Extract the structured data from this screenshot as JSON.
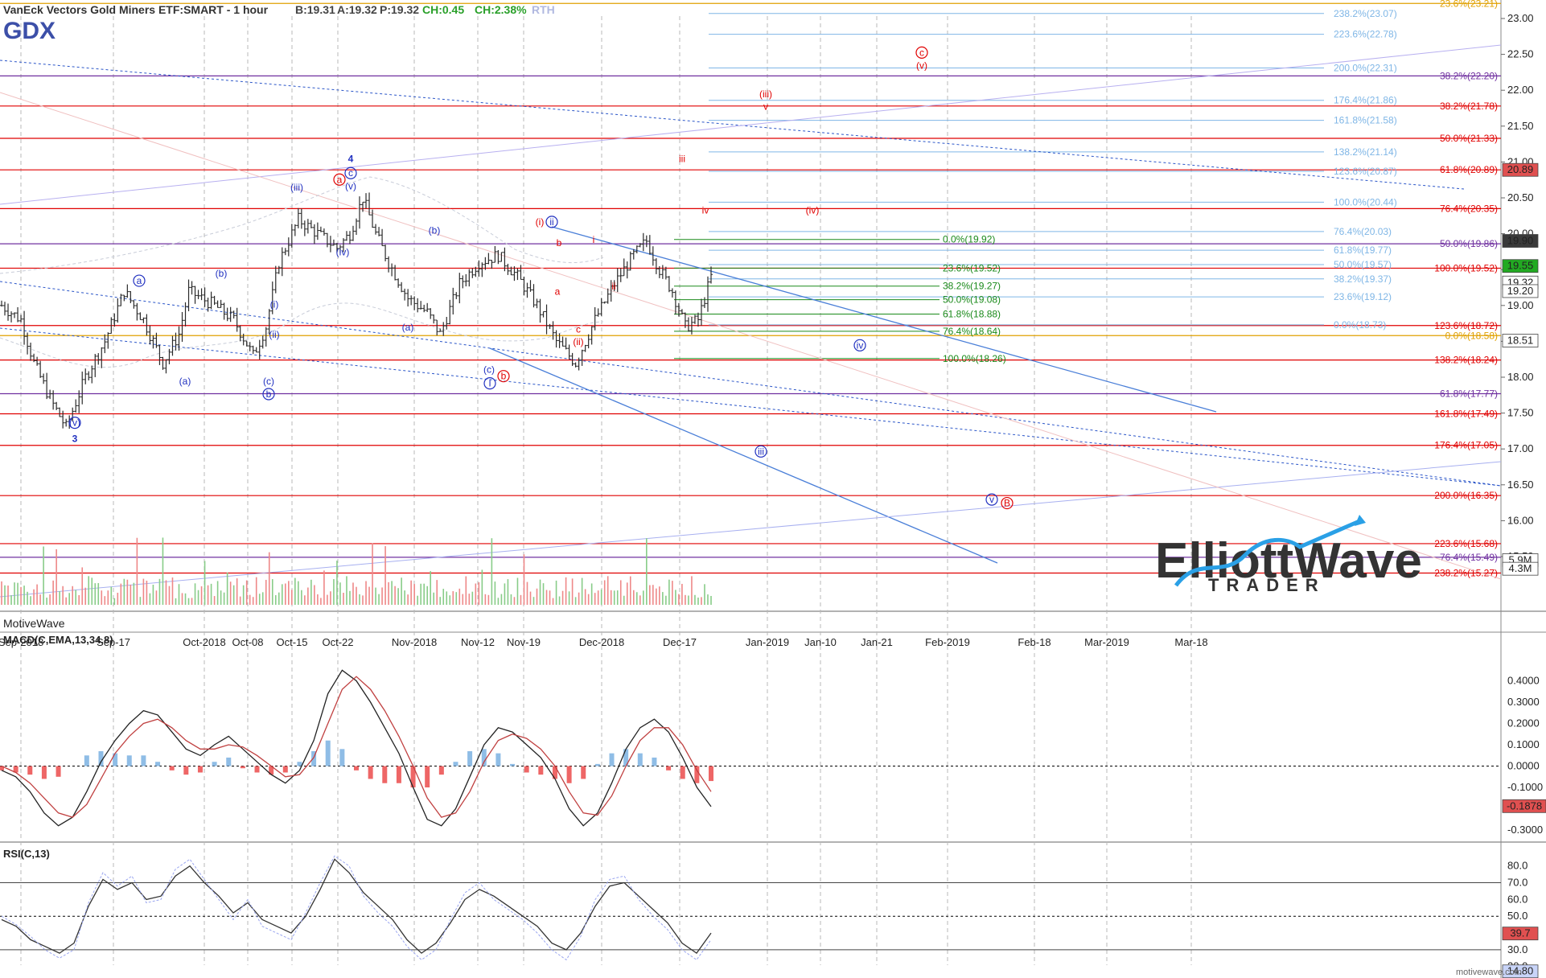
{
  "header": {
    "title": "VanEck Vectors Gold Miners ETF:SMART - 1 hour",
    "symbol": "GDX",
    "bid": "B:19.31",
    "ask": "A:19.32",
    "price": "P:19.32",
    "change": "CH:0.45",
    "change_pct": "CH:2.38%",
    "session": "RTH"
  },
  "watermark": "MotiveWave",
  "footer_brand": "motivewave.com",
  "logo": {
    "line1": "ElliottWave",
    "line2": "TRADER"
  },
  "colors": {
    "price_up": "#2a2a2a",
    "fib_red": "#e00000",
    "fib_purple": "#7030a0",
    "fib_lightblue": "#7fb6e6",
    "fib_green": "#1a8a1a",
    "wave_blue": "#2030c0",
    "wave_red": "#e00000",
    "trend_blue": "#4a7fd8",
    "logo_dark": "#333333",
    "logo_blue": "#2aa0e6",
    "volume_green": "#88cc88",
    "volume_red": "#ee8888",
    "macd_hist_pos": "#8fbde6",
    "macd_hist_neg": "#ee6666"
  },
  "chart_data": [
    {
      "type": "candlestick",
      "title": "VanEck Vectors Gold Miners ETF:SMART - 1 hour",
      "ylim": [
        15.1,
        23.3
      ],
      "x_tick_labels": [
        "Sep-2018",
        "Sep-17",
        "Oct-2018",
        "Oct-08",
        "Oct-15",
        "Oct-22",
        "Nov-2018",
        "Nov-12",
        "Nov-19",
        "Dec-2018",
        "Dec-17",
        "Jan-2019",
        "Jan-10",
        "Jan-21",
        "Feb-2019",
        "Feb-18",
        "Mar-2019",
        "Mar-18"
      ],
      "y_tick_labels": [
        "23.00",
        "22.50",
        "22.00",
        "21.50",
        "21.00",
        "20.50",
        "20.00",
        "19.50",
        "19.00",
        "18.50",
        "18.00",
        "17.50",
        "17.00",
        "16.50",
        "16.00",
        "15.50"
      ],
      "price_path": [
        [
          0,
          19.0
        ],
        [
          6,
          18.8
        ],
        [
          10,
          18.2
        ],
        [
          15,
          17.7
        ],
        [
          20,
          17.3
        ],
        [
          26,
          18.0
        ],
        [
          32,
          18.5
        ],
        [
          38,
          19.2
        ],
        [
          44,
          18.8
        ],
        [
          50,
          18.2
        ],
        [
          55,
          18.6
        ],
        [
          58,
          19.2
        ],
        [
          66,
          19.0
        ],
        [
          72,
          18.8
        ],
        [
          78,
          18.3
        ],
        [
          82,
          18.7
        ],
        [
          86,
          19.6
        ],
        [
          92,
          20.2
        ],
        [
          98,
          20.0
        ],
        [
          104,
          19.8
        ],
        [
          108,
          20.0
        ],
        [
          112,
          20.5
        ],
        [
          116,
          20.0
        ],
        [
          120,
          19.6
        ],
        [
          126,
          19.1
        ],
        [
          132,
          18.9
        ],
        [
          136,
          18.6
        ],
        [
          142,
          19.3
        ],
        [
          148,
          19.6
        ],
        [
          154,
          19.7
        ],
        [
          160,
          19.4
        ],
        [
          166,
          19.0
        ],
        [
          172,
          18.5
        ],
        [
          178,
          18.2
        ],
        [
          184,
          18.8
        ],
        [
          190,
          19.3
        ],
        [
          196,
          19.7
        ],
        [
          200,
          19.9
        ],
        [
          204,
          19.5
        ],
        [
          208,
          19.2
        ],
        [
          212,
          18.7
        ],
        [
          216,
          18.8
        ],
        [
          220,
          19.4
        ]
      ],
      "fib_levels_right": [
        {
          "label": "23.6%(23.21)",
          "value": 23.21,
          "color": "#e0a000"
        },
        {
          "label": "38.2%(22.20)",
          "value": 22.2,
          "color": "#7030a0"
        },
        {
          "label": "38.2%(21.78)",
          "value": 21.78,
          "color": "#e00000"
        },
        {
          "label": "50.0%(21.33)",
          "value": 21.33,
          "color": "#e00000"
        },
        {
          "label": "61.8%(20.89)",
          "value": 20.89,
          "color": "#e00000"
        },
        {
          "label": "76.4%(20.35)",
          "value": 20.35,
          "color": "#e00000"
        },
        {
          "label": "50.0%(19.86)",
          "value": 19.86,
          "color": "#7030a0"
        },
        {
          "label": "100.0%(19.52)",
          "value": 19.52,
          "color": "#e00000"
        },
        {
          "label": "123.6%(18.72)",
          "value": 18.72,
          "color": "#e00000"
        },
        {
          "label": "0.0%(18.58)",
          "value": 18.58,
          "color": "#e0a000"
        },
        {
          "label": "138.2%(18.24)",
          "value": 18.24,
          "color": "#e00000"
        },
        {
          "label": "61.8%(17.77)",
          "value": 17.77,
          "color": "#7030a0"
        },
        {
          "label": "161.8%(17.49)",
          "value": 17.49,
          "color": "#e00000"
        },
        {
          "label": "176.4%(17.05)",
          "value": 17.05,
          "color": "#e00000"
        },
        {
          "label": "200.0%(16.35)",
          "value": 16.35,
          "color": "#e00000"
        },
        {
          "label": "223.6%(15.68)",
          "value": 15.68,
          "color": "#e00000"
        },
        {
          "label": "76.4%(15.49)",
          "value": 15.49,
          "color": "#7030a0"
        },
        {
          "label": "238.2%(15.27)",
          "value": 15.27,
          "color": "#e00000"
        }
      ],
      "fib_levels_mid": [
        {
          "label": "238.2%(23.07)",
          "value": 23.07
        },
        {
          "label": "223.6%(22.78)",
          "value": 22.78
        },
        {
          "label": "200.0%(22.31)",
          "value": 22.31
        },
        {
          "label": "176.4%(21.86)",
          "value": 21.86
        },
        {
          "label": "161.8%(21.58)",
          "value": 21.58
        },
        {
          "label": "138.2%(21.14)",
          "value": 21.14
        },
        {
          "label": "123.6%(20.87)",
          "value": 20.87
        },
        {
          "label": "100.0%(20.44)",
          "value": 20.44
        },
        {
          "label": "76.4%(20.03)",
          "value": 20.03
        },
        {
          "label": "61.8%(19.77)",
          "value": 19.77
        },
        {
          "label": "50.0%(19.57)",
          "value": 19.57
        },
        {
          "label": "38.2%(19.37)",
          "value": 19.37
        },
        {
          "label": "23.6%(19.12)",
          "value": 19.12
        },
        {
          "label": "0.0%(18.73)",
          "value": 18.73
        }
      ],
      "fib_levels_green": [
        {
          "label": "0.0%(19.92)",
          "value": 19.92
        },
        {
          "label": "23.6%(19.52)",
          "value": 19.52
        },
        {
          "label": "38.2%(19.27)",
          "value": 19.27
        },
        {
          "label": "50.0%(19.08)",
          "value": 19.08
        },
        {
          "label": "61.8%(18.88)",
          "value": 18.88
        },
        {
          "label": "76.4%(18.64)",
          "value": 18.64
        },
        {
          "label": "100.0%(18.26)",
          "value": 18.26
        }
      ],
      "price_badges": [
        {
          "label": "20.89",
          "value": 20.89,
          "bg": "#e05050",
          "fg": "#000"
        },
        {
          "label": "19.90",
          "value": 19.9,
          "bg": "#3a3a3a",
          "fg": "#fff"
        },
        {
          "label": "19.55",
          "value": 19.55,
          "bg": "#22aa22",
          "fg": "#fff"
        },
        {
          "label": "19.32",
          "value": 19.32,
          "bg": "#ffffff",
          "fg": "#000"
        },
        {
          "label": "19.20",
          "value": 19.2,
          "bg": "#ffffff",
          "fg": "#000"
        },
        {
          "label": "18.51",
          "value": 18.51,
          "bg": "#ffffff",
          "fg": "#000"
        },
        {
          "label": "5.9M",
          "value": 15.45,
          "bg": "#ffffff",
          "fg": "#000"
        },
        {
          "label": "4.3M",
          "value": 15.33,
          "bg": "#ffffff",
          "fg": "#000"
        }
      ],
      "wave_labels": [
        {
          "t": "(v)",
          "x": 93,
          "v": 17.32,
          "c": "#2030c0",
          "circ": true
        },
        {
          "t": "3",
          "x": 93,
          "v": 17.1,
          "c": "#2030c0",
          "circ": false
        },
        {
          "t": "a",
          "x": 173,
          "v": 19.3,
          "c": "#2030c0",
          "circ": true
        },
        {
          "t": "(a)",
          "x": 230,
          "v": 17.9,
          "c": "#2030c0",
          "circ": false
        },
        {
          "t": "(b)",
          "x": 275,
          "v": 19.4,
          "c": "#2030c0",
          "circ": false
        },
        {
          "t": "(i)",
          "x": 341,
          "v": 18.97,
          "c": "#2030c0",
          "circ": false
        },
        {
          "t": "(ii)",
          "x": 341,
          "v": 18.55,
          "c": "#2030c0",
          "circ": false
        },
        {
          "t": "(c)",
          "x": 334,
          "v": 17.9,
          "c": "#2030c0",
          "circ": false
        },
        {
          "t": "b",
          "x": 334,
          "v": 17.72,
          "c": "#2030c0",
          "circ": true
        },
        {
          "t": "(iii)",
          "x": 369,
          "v": 20.6,
          "c": "#2030c0",
          "circ": false
        },
        {
          "t": "(iv)",
          "x": 426,
          "v": 19.7,
          "c": "#2030c0",
          "circ": false
        },
        {
          "t": "4",
          "x": 436,
          "v": 21.0,
          "c": "#2030c0",
          "circ": false
        },
        {
          "t": "c",
          "x": 436,
          "v": 20.8,
          "c": "#2030c0",
          "circ": true
        },
        {
          "t": "(v)",
          "x": 436,
          "v": 20.62,
          "c": "#2030c0",
          "circ": false
        },
        {
          "t": "a",
          "x": 422,
          "v": 20.71,
          "c": "#e00000",
          "circ": true
        },
        {
          "t": "(b)",
          "x": 540,
          "v": 20.0,
          "c": "#2030c0",
          "circ": false
        },
        {
          "t": "(a)",
          "x": 507,
          "v": 18.65,
          "c": "#2030c0",
          "circ": false
        },
        {
          "t": "(c)",
          "x": 608,
          "v": 18.06,
          "c": "#2030c0",
          "circ": false
        },
        {
          "t": "I",
          "x": 609,
          "v": 17.87,
          "c": "#2030c0",
          "circ": true
        },
        {
          "t": "b",
          "x": 626,
          "v": 17.97,
          "c": "#e00000",
          "circ": true
        },
        {
          "t": "(i)",
          "x": 671,
          "v": 20.12,
          "c": "#e00000",
          "circ": false
        },
        {
          "t": "ii",
          "x": 686,
          "v": 20.12,
          "c": "#2030c0",
          "circ": true
        },
        {
          "t": "b",
          "x": 695,
          "v": 19.83,
          "c": "#e00000",
          "circ": false
        },
        {
          "t": "a",
          "x": 693,
          "v": 19.15,
          "c": "#e00000",
          "circ": false
        },
        {
          "t": "c",
          "x": 719,
          "v": 18.62,
          "c": "#e00000",
          "circ": false
        },
        {
          "t": "(ii)",
          "x": 719,
          "v": 18.45,
          "c": "#e00000",
          "circ": false
        },
        {
          "t": "i",
          "x": 738,
          "v": 19.87,
          "c": "#e00000",
          "circ": false
        },
        {
          "t": "ii",
          "x": 763,
          "v": 19.22,
          "c": "#e00000",
          "circ": false
        },
        {
          "t": "iii",
          "x": 848,
          "v": 21.0,
          "c": "#e00000",
          "circ": false
        },
        {
          "t": "iv",
          "x": 877,
          "v": 20.28,
          "c": "#e00000",
          "circ": false
        },
        {
          "t": "(iii)",
          "x": 952,
          "v": 21.9,
          "c": "#e00000",
          "circ": false
        },
        {
          "t": "v",
          "x": 952,
          "v": 21.73,
          "c": "#e00000",
          "circ": false
        },
        {
          "t": "(iv)",
          "x": 1010,
          "v": 20.28,
          "c": "#e00000",
          "circ": false
        },
        {
          "t": "c",
          "x": 1146,
          "v": 22.48,
          "c": "#e00000",
          "circ": true
        },
        {
          "t": "(v)",
          "x": 1146,
          "v": 22.3,
          "c": "#e00000",
          "circ": false
        },
        {
          "t": "iv",
          "x": 1069,
          "v": 18.4,
          "c": "#2030c0",
          "circ": true
        },
        {
          "t": "iii",
          "x": 946,
          "v": 16.92,
          "c": "#2030c0",
          "circ": true
        },
        {
          "t": "v",
          "x": 1233,
          "v": 16.25,
          "c": "#2030c0",
          "circ": true
        },
        {
          "t": "B",
          "x": 1252,
          "v": 16.2,
          "c": "#e00000",
          "circ": true
        }
      ]
    },
    {
      "type": "line",
      "title": "MACD(C,EMA,13,34,8)",
      "ylim": [
        -0.33,
        0.5
      ],
      "y_tick_labels": [
        "0.4000",
        "0.3000",
        "0.2000",
        "0.1000",
        "0.0000",
        "-0.1000",
        "-0.2000",
        "-0.3000"
      ],
      "current_value": "-0.1878",
      "series": [
        {
          "values": [
            -0.02,
            -0.05,
            -0.12,
            -0.22,
            -0.28,
            -0.24,
            -0.12,
            0.02,
            0.12,
            0.2,
            0.26,
            0.24,
            0.16,
            0.08,
            0.05,
            0.1,
            0.14,
            0.08,
            0.02,
            -0.04,
            -0.08,
            -0.02,
            0.12,
            0.34,
            0.45,
            0.4,
            0.3,
            0.18,
            0.06,
            -0.1,
            -0.25,
            -0.28,
            -0.2,
            -0.05,
            0.1,
            0.18,
            0.16,
            0.1,
            0.04,
            -0.06,
            -0.2,
            -0.28,
            -0.22,
            -0.08,
            0.08,
            0.18,
            0.22,
            0.16,
            0.04,
            -0.1,
            -0.19
          ]
        },
        {
          "values": [
            0.0,
            -0.03,
            -0.08,
            -0.15,
            -0.22,
            -0.24,
            -0.18,
            -0.06,
            0.06,
            0.14,
            0.2,
            0.22,
            0.18,
            0.12,
            0.08,
            0.08,
            0.1,
            0.09,
            0.05,
            0.0,
            -0.05,
            -0.04,
            0.04,
            0.2,
            0.36,
            0.42,
            0.36,
            0.26,
            0.14,
            0.0,
            -0.15,
            -0.24,
            -0.22,
            -0.12,
            0.02,
            0.12,
            0.15,
            0.13,
            0.08,
            0.0,
            -0.12,
            -0.22,
            -0.23,
            -0.14,
            0.0,
            0.12,
            0.18,
            0.18,
            0.1,
            -0.02,
            -0.12
          ]
        }
      ],
      "histogram": [
        -0.02,
        -0.03,
        -0.04,
        -0.06,
        -0.05,
        0.0,
        0.05,
        0.07,
        0.06,
        0.05,
        0.05,
        0.02,
        -0.02,
        -0.04,
        -0.03,
        0.02,
        0.04,
        -0.01,
        -0.03,
        -0.04,
        -0.03,
        0.02,
        0.07,
        0.12,
        0.08,
        -0.02,
        -0.06,
        -0.08,
        -0.08,
        -0.1,
        -0.1,
        -0.04,
        0.02,
        0.07,
        0.08,
        0.06,
        0.01,
        -0.03,
        -0.04,
        -0.06,
        -0.08,
        -0.06,
        0.01,
        0.06,
        0.08,
        0.06,
        0.04,
        -0.02,
        -0.06,
        -0.08,
        -0.07
      ]
    },
    {
      "type": "line",
      "title": "RSI(C,13)",
      "ylim": [
        17,
        88
      ],
      "y_tick_labels": [
        "80.0",
        "70.0",
        "60.0",
        "50.0",
        "40.0",
        "30.0",
        "20.0"
      ],
      "current_value": "39.7",
      "lower_value": "14.80",
      "series": [
        {
          "values": [
            48,
            44,
            36,
            32,
            28,
            34,
            56,
            72,
            66,
            70,
            60,
            62,
            74,
            80,
            70,
            62,
            52,
            58,
            48,
            44,
            40,
            50,
            66,
            84,
            76,
            64,
            56,
            48,
            36,
            28,
            34,
            46,
            60,
            66,
            62,
            56,
            50,
            44,
            34,
            30,
            40,
            56,
            68,
            70,
            62,
            54,
            46,
            34,
            28,
            40
          ]
        },
        {
          "values": [
            50,
            45,
            38,
            30,
            25,
            30,
            58,
            76,
            68,
            74,
            58,
            60,
            78,
            84,
            72,
            60,
            48,
            60,
            44,
            40,
            36,
            52,
            70,
            86,
            80,
            62,
            52,
            44,
            32,
            24,
            30,
            48,
            64,
            70,
            60,
            54,
            48,
            40,
            30,
            24,
            38,
            60,
            72,
            74,
            60,
            50,
            42,
            30,
            24,
            36
          ]
        }
      ]
    }
  ]
}
